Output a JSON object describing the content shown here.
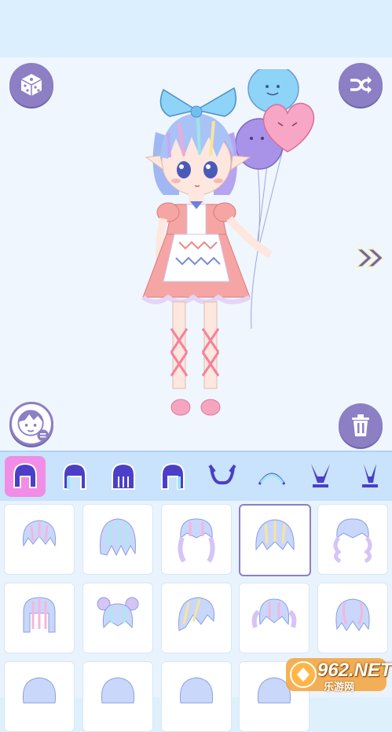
{
  "app": {
    "accent_color": "#8c7fc4",
    "active_tab_color": "#f18de6"
  },
  "stage": {
    "top_left_button_icon": "dice-icon",
    "top_right_button_icon": "shuffle-icon",
    "next_icon": "double-chevron-right-icon",
    "bottom_left_button_icon": "face-swap-icon",
    "bottom_right_button_icon": "trash-icon"
  },
  "categories": [
    {
      "icon": "hair-front-icon",
      "active": true
    },
    {
      "icon": "hair-side-icon",
      "active": false
    },
    {
      "icon": "hair-back-icon",
      "active": false
    },
    {
      "icon": "hair-long-icon",
      "active": false
    },
    {
      "icon": "horns-icon",
      "active": false
    },
    {
      "icon": "headband-icon",
      "active": false
    },
    {
      "icon": "bunny-ears-icon",
      "active": false
    },
    {
      "icon": "bunny-ears-alt-icon",
      "active": false
    }
  ],
  "hair_items": [
    {
      "style": "short-bob",
      "selected": false
    },
    {
      "style": "spiky-messy",
      "selected": false
    },
    {
      "style": "long-braids",
      "selected": false
    },
    {
      "style": "medium-layered",
      "selected": true
    },
    {
      "style": "curly-medium",
      "selected": false
    },
    {
      "style": "straight-bob",
      "selected": false
    },
    {
      "style": "buns-curly",
      "selected": false
    },
    {
      "style": "side-swept",
      "selected": false
    },
    {
      "style": "pigtails",
      "selected": false
    },
    {
      "style": "wavy-short",
      "selected": false
    }
  ],
  "watermark": {
    "text": "962.NET",
    "subtext": "乐游网"
  }
}
